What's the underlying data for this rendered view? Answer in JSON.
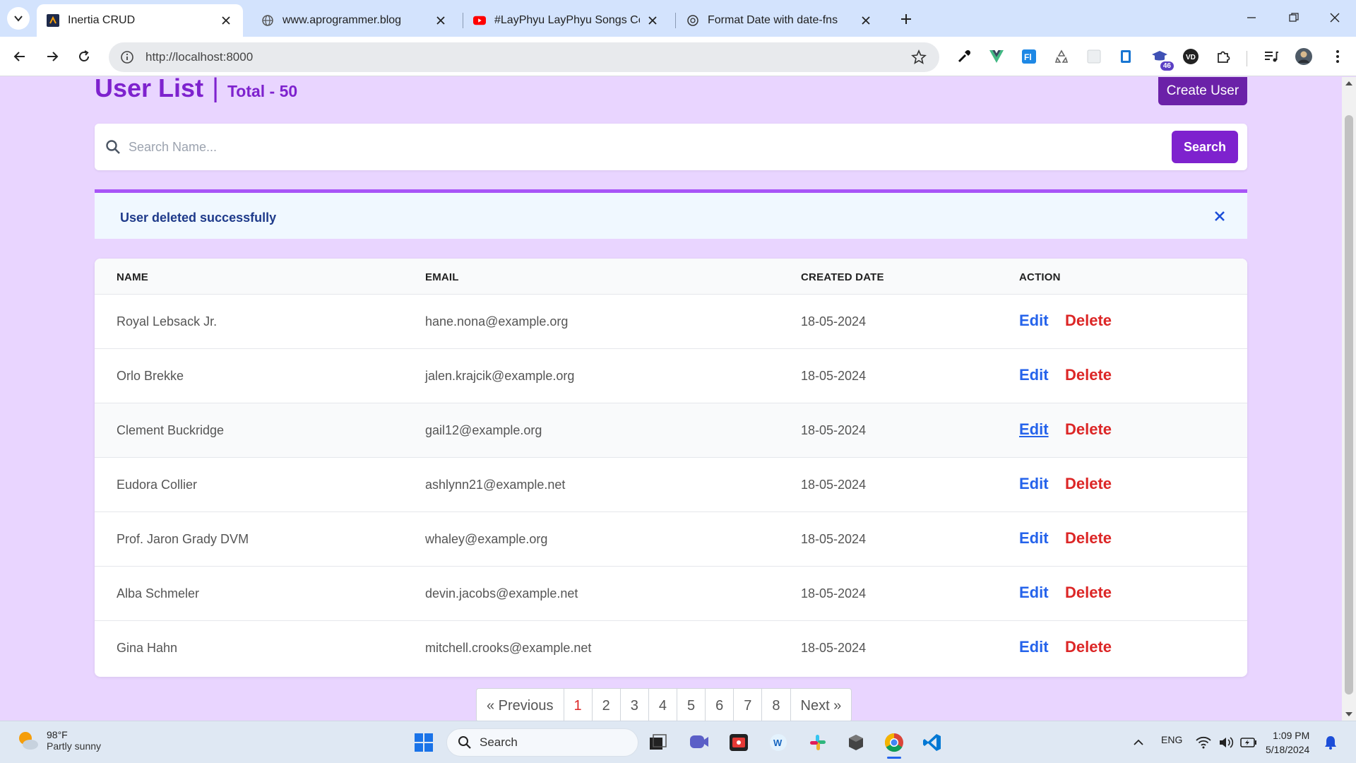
{
  "browser": {
    "tabs": [
      {
        "title": "Inertia CRUD",
        "active": true,
        "favicon": "inertia-favicon"
      },
      {
        "title": "www.aprogrammer.blog",
        "active": false,
        "favicon": "globe-icon"
      },
      {
        "title": "#LayPhyu LayPhyu Songs Colle",
        "active": false,
        "favicon": "youtube-icon"
      },
      {
        "title": "Format Date with date-fns",
        "active": false,
        "favicon": "openai-icon"
      }
    ],
    "url": "http://localhost:8000",
    "extension_badge": "46"
  },
  "page": {
    "title": "User List",
    "separator": "|",
    "total": "Total - 50",
    "create_button": "Create User",
    "search": {
      "placeholder": "Search Name...",
      "button": "Search"
    },
    "alert": {
      "message": "User deleted successfully"
    },
    "table": {
      "headers": [
        "NAME",
        "EMAIL",
        "CREATED DATE",
        "ACTION"
      ],
      "rows": [
        {
          "name": "Royal Lebsack Jr.",
          "email": "hane.nona@example.org",
          "created": "18-05-2024",
          "edit": "Edit",
          "delete": "Delete"
        },
        {
          "name": "Orlo Brekke",
          "email": "jalen.krajcik@example.org",
          "created": "18-05-2024",
          "edit": "Edit",
          "delete": "Delete"
        },
        {
          "name": "Clement Buckridge",
          "email": "gail12@example.org",
          "created": "18-05-2024",
          "edit": "Edit",
          "delete": "Delete"
        },
        {
          "name": "Eudora Collier",
          "email": "ashlynn21@example.net",
          "created": "18-05-2024",
          "edit": "Edit",
          "delete": "Delete"
        },
        {
          "name": "Prof. Jaron Grady DVM",
          "email": "whaley@example.org",
          "created": "18-05-2024",
          "edit": "Edit",
          "delete": "Delete"
        },
        {
          "name": "Alba Schmeler",
          "email": "devin.jacobs@example.net",
          "created": "18-05-2024",
          "edit": "Edit",
          "delete": "Delete"
        },
        {
          "name": "Gina Hahn",
          "email": "mitchell.crooks@example.net",
          "created": "18-05-2024",
          "edit": "Edit",
          "delete": "Delete"
        }
      ]
    },
    "pagination": {
      "previous": "« Previous",
      "pages": [
        "1",
        "2",
        "3",
        "4",
        "5",
        "6",
        "7",
        "8"
      ],
      "active": "1",
      "next": "Next »"
    }
  },
  "taskbar": {
    "weather_temp": "98°F",
    "weather_condition": "Partly sunny",
    "search_label": "Search",
    "language": "ENG",
    "time": "1:09 PM",
    "date": "5/18/2024"
  },
  "colors": {
    "page_background": "#e9d5ff",
    "accent_purple": "#7e22ce",
    "create_button": "#6b21a8",
    "edit_link": "#2563eb",
    "delete_link": "#dc2626",
    "alert_border": "#a855f7"
  }
}
